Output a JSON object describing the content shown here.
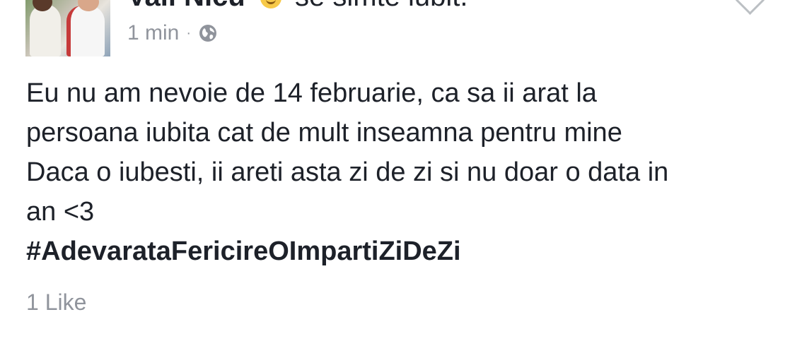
{
  "post": {
    "author": "Vali Nicu",
    "feeling": "se simte iubit.",
    "timestamp": "1 min",
    "separator": "·",
    "privacy_icon": "globe-icon",
    "feeling_icon": "smiley-icon",
    "text_lines": [
      "Eu nu am nevoie de 14 februarie, ca sa ii arat la",
      "persoana iubita cat de mult inseamna pentru mine",
      "Daca o iubesti, ii areti asta zi de zi si nu doar o data in",
      "an <3"
    ],
    "hashtag": "#AdevarataFericireOImpartiZiDeZi",
    "likes": "1 Like"
  },
  "colors": {
    "text": "#1d2129",
    "secondary": "#90949c",
    "background": "#ffffff"
  }
}
